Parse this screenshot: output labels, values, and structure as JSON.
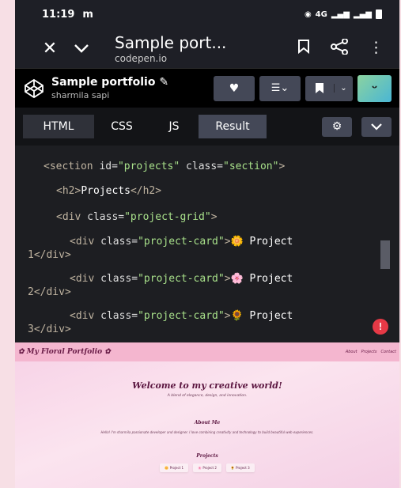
{
  "status": {
    "time": "11:19",
    "carrier_icon": "m",
    "network": "4G"
  },
  "browser": {
    "title": "Sample port...",
    "url": "codepen.io"
  },
  "pen": {
    "name": "Sample portfolio",
    "author": "sharmila sapi",
    "edit_icon": "pencil-icon"
  },
  "tabs": [
    {
      "label": "HTML"
    },
    {
      "label": "CSS"
    },
    {
      "label": "JS"
    },
    {
      "label": "Result"
    }
  ],
  "code": {
    "l1_open": "<section ",
    "l1_attr1": "id=",
    "l1_val1": "\"projects\"",
    "l1_attr2": " class=",
    "l1_val2": "\"section\"",
    "l1_close": ">",
    "l2_open": "<h2>",
    "l2_text": "Projects",
    "l2_close": "</h2>",
    "l3_open": "<div ",
    "l3_attr": "class=",
    "l3_val": "\"project-grid\"",
    "l3_close": ">",
    "card_open": "<div ",
    "card_attr": "class=",
    "card_val": "\"project-card\"",
    "card_close": ">",
    "p1_text": "🌼 Project",
    "p1_end": "1</div>",
    "p2_text": "🌸 Project",
    "p2_end": "2</div>",
    "p3_text": "🌻 Project",
    "p3_end": "3</div>",
    "error": "!"
  },
  "preview": {
    "brand": "✿ My Floral Portfolio ✿",
    "links": [
      "About",
      "Projects",
      "Contact"
    ],
    "hero_title": "Welcome to my creative world!",
    "hero_sub": "A blend of elegance, design, and innovation.",
    "about_title": "About Me",
    "about_text": "Hello! I'm sharmila passionate developer and designer. I love combining creativity and technology to build beautiful web experiences.",
    "projects_title": "Projects",
    "cards": [
      "🌼 Project 1",
      "🌸 Project 2",
      "🌻 Project 3"
    ]
  },
  "colors": {
    "accent_pink": "#f4b6cf",
    "editor_bg": "#1d1e22",
    "string_green": "#a8e08a"
  }
}
